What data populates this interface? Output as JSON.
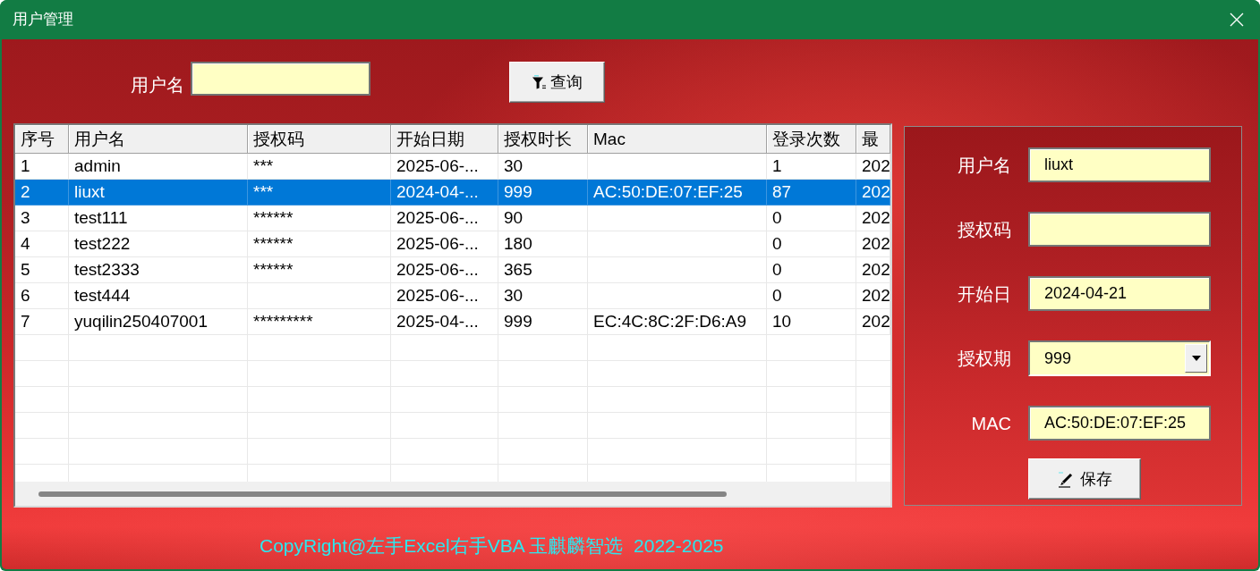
{
  "window": {
    "title": "用户管理"
  },
  "search": {
    "label": "用户名",
    "button": "查询"
  },
  "table": {
    "columns": [
      "序号",
      "用户名",
      "授权码",
      "开始日期",
      "授权时长",
      "Mac",
      "登录次数",
      "最"
    ],
    "rows": [
      {
        "selected": false,
        "no": "1",
        "username": "admin",
        "auth_code": "***",
        "start_date": "2025-06-...",
        "duration": "30",
        "logins": "1",
        "column_8": "202"
      },
      {
        "selected": true,
        "no": "2",
        "username": "liuxt",
        "auth_code": "***",
        "start_date": "2024-04-...",
        "duration": "999",
        "mac": "AC:50:DE:07:EF:25",
        "logins": "87",
        "column_8": "202"
      },
      {
        "selected": false,
        "no": "3",
        "username": "test111",
        "auth_code": "******",
        "start_date": "2025-06-...",
        "duration": "90",
        "logins": "0",
        "column_8": "202"
      },
      {
        "selected": false,
        "no": "4",
        "username": "test222",
        "auth_code": "******",
        "start_date": "2025-06-...",
        "duration": "180",
        "logins": "0",
        "column_8": "202"
      },
      {
        "selected": false,
        "no": "5",
        "username": "test2333",
        "auth_code": "******",
        "start_date": "2025-06-...",
        "duration": "365",
        "logins": "0",
        "column_8": "202"
      },
      {
        "selected": false,
        "no": "6",
        "username": "test444",
        "start_date": "2025-06-...",
        "duration": "30",
        "logins": "0",
        "column_8": "202"
      },
      {
        "selected": false,
        "no": "7",
        "username": "yuqilin250407001",
        "auth_code": "*********",
        "start_date": "2025-04-...",
        "duration": "999",
        "mac": "EC:4C:8C:2F:D6:A9",
        "logins": "10",
        "column_8": "202"
      }
    ]
  },
  "edit_panel": {
    "fields": [
      {
        "kind": "text",
        "label": "用户名",
        "value": "liuxt"
      },
      {
        "kind": "text",
        "label": "授权码"
      },
      {
        "kind": "text",
        "label": "开始日",
        "value": "2024-04-21"
      },
      {
        "kind": "combo",
        "label": "授权期",
        "value": "999"
      },
      {
        "kind": "text",
        "label": "MAC",
        "value": "AC:50:DE:07:EF:25"
      }
    ],
    "save_button": "保存"
  },
  "footer": {
    "copyright": "CopyRight@左手Excel右手VBA 玉麒麟智选  2022-2025"
  }
}
